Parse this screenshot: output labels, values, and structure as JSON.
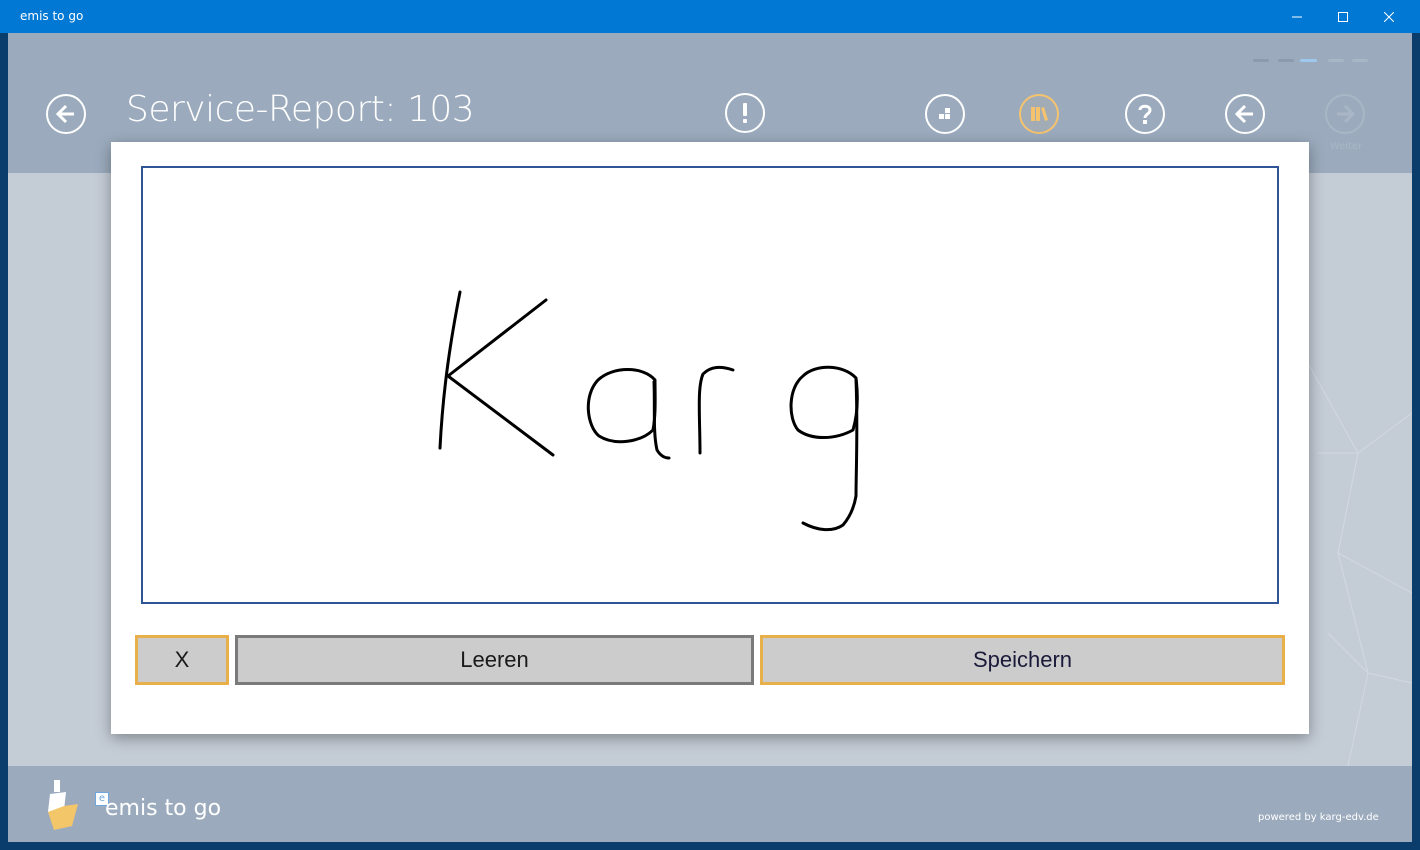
{
  "window": {
    "title": "emis to go",
    "minimize_icon": "minimize-icon",
    "maximize_icon": "maximize-icon",
    "close_icon": "close-icon"
  },
  "header": {
    "title": "Service-Report: 103",
    "next_label": "Weiter",
    "progress_steps": 5,
    "active_step": 3,
    "icons": [
      "back-arrow-icon",
      "exclamation-icon",
      "tiles-icon",
      "books-icon",
      "question-icon",
      "back-arrow-icon",
      "forward-arrow-icon"
    ],
    "accent_color": "#f5c36e"
  },
  "dialog": {
    "signature_text": "Karg",
    "buttons": {
      "close_label": "X",
      "clear_label": "Leeren",
      "save_label": "Speichern"
    },
    "border_color": "#2f5597",
    "button_highlight_color": "#e8b04a"
  },
  "footer": {
    "app_name": "emis to go",
    "powered_by": "powered by karg-edv.de"
  }
}
